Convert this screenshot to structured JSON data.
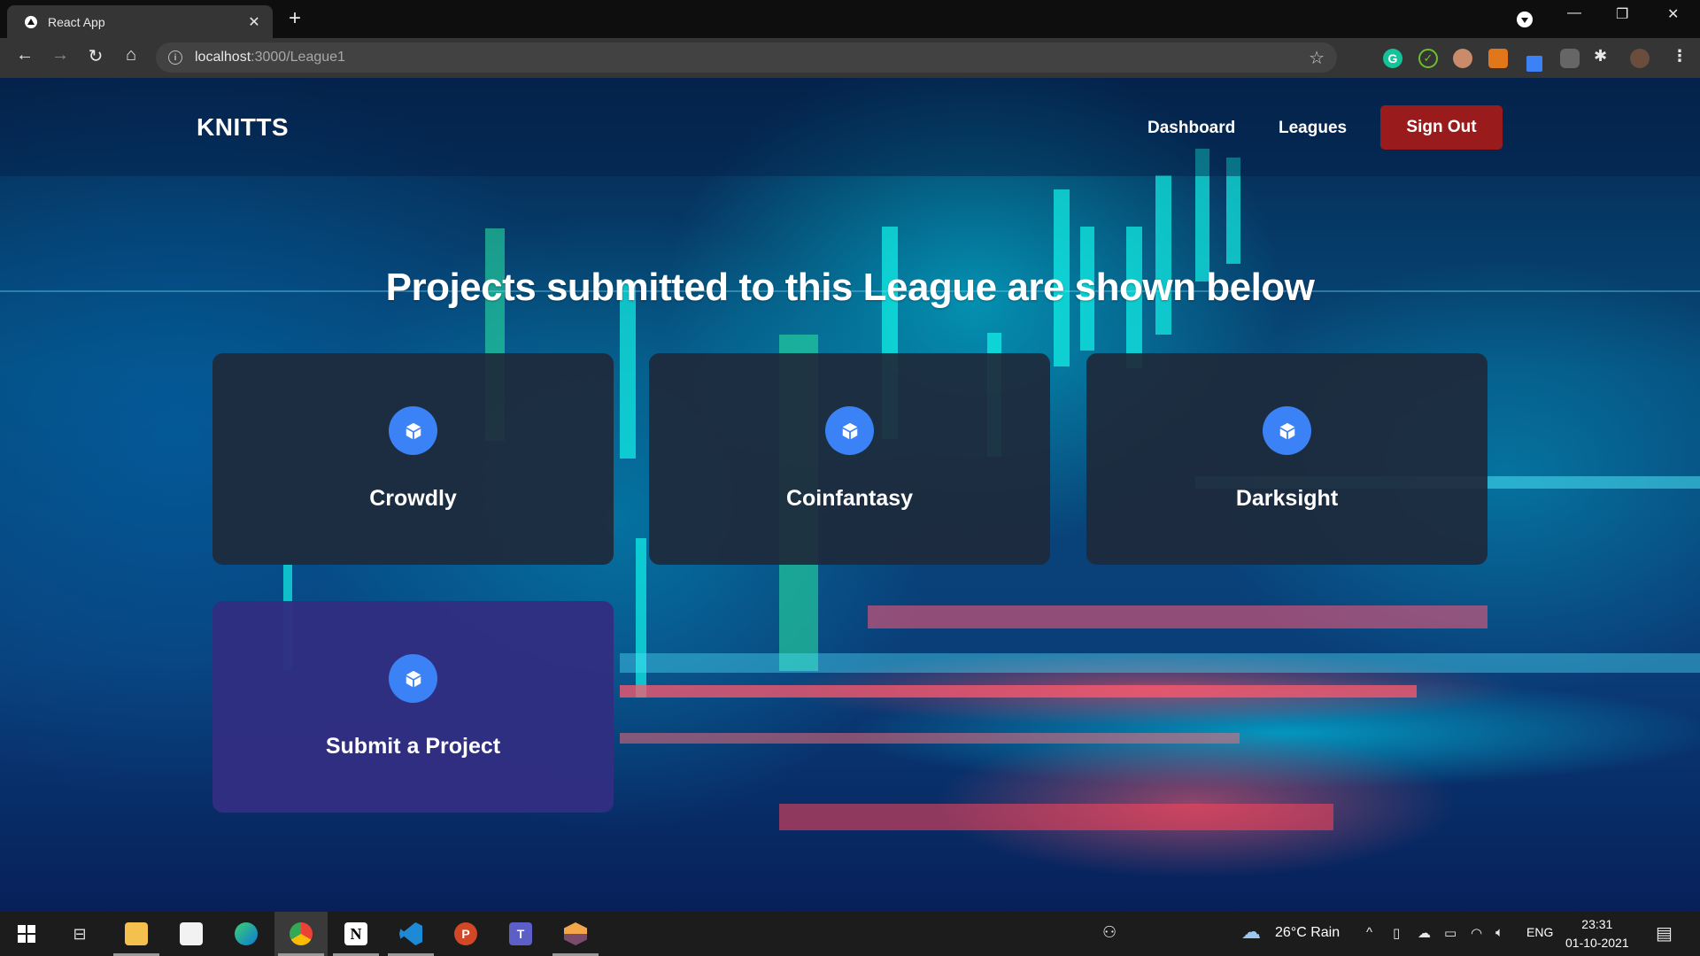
{
  "browser": {
    "tab_title": "React App",
    "url_host": "localhost",
    "url_path": ":3000/League1",
    "extensions": [
      "grammarly-icon",
      "check-extension-icon",
      "glasses-extension-icon",
      "metamask-fox-icon",
      "color-picker-icon",
      "screen-recorder-icon",
      "extensions-puzzle-icon",
      "profile-avatar"
    ]
  },
  "navbar": {
    "brand": "KNITTS",
    "links": [
      {
        "label": "Dashboard"
      },
      {
        "label": "Leagues"
      }
    ],
    "signout_label": "Sign Out",
    "signout_color": "#991b1b"
  },
  "main": {
    "heading": "Projects submitted to this League are shown below",
    "projects": [
      {
        "name": "Crowdly",
        "icon": "cube-icon"
      },
      {
        "name": "Coinfantasy",
        "icon": "cube-icon"
      },
      {
        "name": "Darksight",
        "icon": "cube-icon"
      }
    ],
    "submit_card": {
      "label": "Submit a Project",
      "icon": "cube-icon"
    },
    "colors": {
      "card_bg": "#1e293b",
      "submit_bg": "#312e81",
      "icon_circle": "#3b82f6"
    }
  },
  "taskbar": {
    "apps": [
      "Start",
      "Task View",
      "File Explorer",
      "Microsoft Store",
      "Edge",
      "Chrome",
      "Notion",
      "VS Code",
      "PowerPoint",
      "Teams",
      "App"
    ],
    "weather": "26°C  Rain",
    "language": "ENG",
    "time": "23:31",
    "date": "01-10-2021"
  }
}
